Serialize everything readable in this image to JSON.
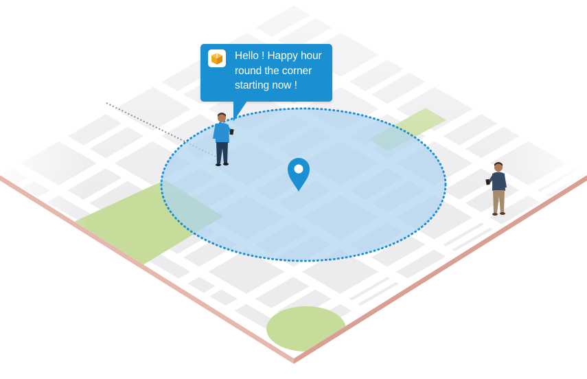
{
  "notification": {
    "lines": [
      "Hello ! Happy hour",
      "round the corner",
      "starting now !"
    ],
    "app_icon": "gift-box-icon"
  },
  "map": {
    "location_pin": "location-pin-icon",
    "geofence": "dotted-circle"
  },
  "people": [
    "person-with-phone-inside-zone",
    "person-with-phone-outside-zone"
  ],
  "colors": {
    "bubble": "#1a8fd1",
    "geofence_fill": "#aed4ee",
    "geofence_border": "#1a8fd1",
    "pin": "#1a8fd1",
    "park": "#c6dc9b",
    "block": "#ececef",
    "road": "#ffffff",
    "map_edge": "#e3b3a8",
    "icon_orange": "#f2a51a"
  }
}
